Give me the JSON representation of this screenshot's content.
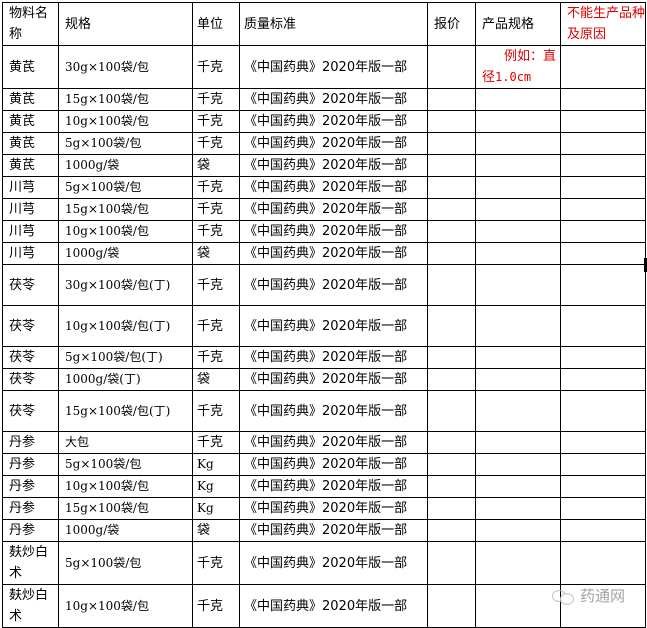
{
  "table": {
    "headers": {
      "name": "物料名称",
      "spec": "规格",
      "unit": "单位",
      "standard": "质量标准",
      "price": "报价",
      "product_spec": "产品规格",
      "reason": "不能生产品种及原因"
    },
    "example_note": {
      "line1": "例如：直",
      "line2_cjk": "径",
      "line2_value": "1.0cm"
    },
    "rows": [
      {
        "name": "黄芪",
        "spec": "30g×100袋/包",
        "unit": "千克",
        "standard": "《中国药典》2020年版一部",
        "price": "",
        "product_spec": "",
        "reason": ""
      },
      {
        "name": "黄芪",
        "spec": "15g×100袋/包",
        "unit": "千克",
        "standard": "《中国药典》2020年版一部",
        "price": "",
        "product_spec": "",
        "reason": ""
      },
      {
        "name": "黄芪",
        "spec": "10g×100袋/包",
        "unit": "千克",
        "standard": "《中国药典》2020年版一部",
        "price": "",
        "product_spec": "",
        "reason": ""
      },
      {
        "name": "黄芪",
        "spec": "5g×100袋/包",
        "unit": "千克",
        "standard": "《中国药典》2020年版一部",
        "price": "",
        "product_spec": "",
        "reason": ""
      },
      {
        "name": "黄芪",
        "spec": "1000g/袋",
        "unit": "袋",
        "standard": "《中国药典》2020年版一部",
        "price": "",
        "product_spec": "",
        "reason": ""
      },
      {
        "name": "川芎",
        "spec": "5g×100袋/包",
        "unit": "千克",
        "standard": "《中国药典》2020年版一部",
        "price": "",
        "product_spec": "",
        "reason": ""
      },
      {
        "name": "川芎",
        "spec": "15g×100袋/包",
        "unit": "千克",
        "standard": "《中国药典》2020年版一部",
        "price": "",
        "product_spec": "",
        "reason": ""
      },
      {
        "name": "川芎",
        "spec": "10g×100袋/包",
        "unit": "千克",
        "standard": "《中国药典》2020年版一部",
        "price": "",
        "product_spec": "",
        "reason": ""
      },
      {
        "name": "川芎",
        "spec": "1000g/袋",
        "unit": "袋",
        "standard": "《中国药典》2020年版一部",
        "price": "",
        "product_spec": "",
        "reason": ""
      },
      {
        "name": "茯苓",
        "spec": "30g×100袋/包(丁)",
        "unit": "千克",
        "standard": "《中国药典》2020年版一部",
        "price": "",
        "product_spec": "",
        "reason": ""
      },
      {
        "name": "茯苓",
        "spec": "10g×100袋/包(丁)",
        "unit": "千克",
        "standard": "《中国药典》2020年版一部",
        "price": "",
        "product_spec": "",
        "reason": ""
      },
      {
        "name": "茯苓",
        "spec": "5g×100袋/包(丁)",
        "unit": "千克",
        "standard": "《中国药典》2020年版一部",
        "price": "",
        "product_spec": "",
        "reason": ""
      },
      {
        "name": "茯苓",
        "spec": "1000g/袋(丁)",
        "unit": "袋",
        "standard": "《中国药典》2020年版一部",
        "price": "",
        "product_spec": "",
        "reason": ""
      },
      {
        "name": "茯苓",
        "spec": "15g×100袋/包(丁)",
        "unit": "千克",
        "standard": "《中国药典》2020年版一部",
        "price": "",
        "product_spec": "",
        "reason": ""
      },
      {
        "name": "丹参",
        "spec": "大包",
        "unit": "千克",
        "standard": "《中国药典》2020年版一部",
        "price": "",
        "product_spec": "",
        "reason": ""
      },
      {
        "name": "丹参",
        "spec": "5g×100袋/包",
        "unit": "Kg",
        "standard": "《中国药典》2020年版一部",
        "price": "",
        "product_spec": "",
        "reason": ""
      },
      {
        "name": "丹参",
        "spec": "10g×100袋/包",
        "unit": "Kg",
        "standard": "《中国药典》2020年版一部",
        "price": "",
        "product_spec": "",
        "reason": ""
      },
      {
        "name": "丹参",
        "spec": "15g×100袋/包",
        "unit": "Kg",
        "standard": "《中国药典》2020年版一部",
        "price": "",
        "product_spec": "",
        "reason": ""
      },
      {
        "name": "丹参",
        "spec": "1000g/袋",
        "unit": "袋",
        "standard": "《中国药典》2020年版一部",
        "price": "",
        "product_spec": "",
        "reason": ""
      },
      {
        "name": "麸炒白术",
        "spec": "5g×100袋/包",
        "unit": "千克",
        "standard": "《中国药典》2020年版一部",
        "price": "",
        "product_spec": "",
        "reason": ""
      },
      {
        "name": "麸炒白术",
        "spec": "10g×100袋/包",
        "unit": "千克",
        "standard": "《中国药典》2020年版一部",
        "price": "",
        "product_spec": "",
        "reason": ""
      }
    ]
  },
  "watermark": {
    "icon": "wechat-icon",
    "text": "药通网"
  },
  "colors": {
    "note_red": "#e00000",
    "border": "#000000",
    "watermark_gray": "#9a9a9a"
  }
}
